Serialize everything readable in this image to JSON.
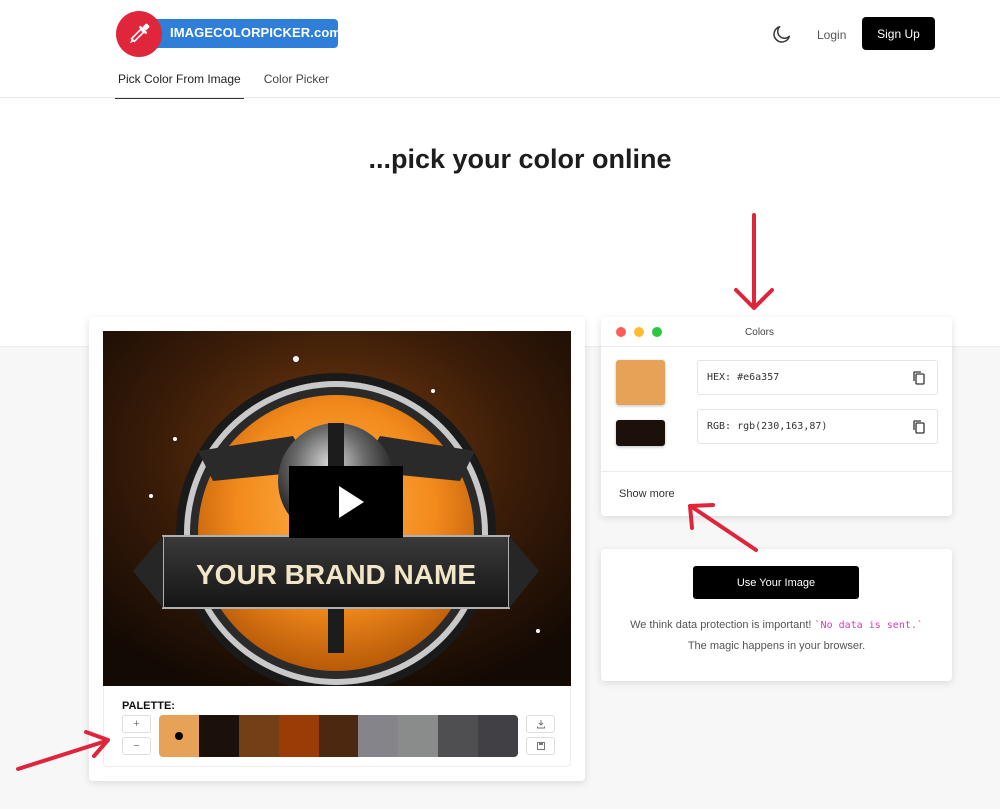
{
  "header": {
    "logo_text": "IMAGECOLORPICKER.com",
    "tabs": [
      {
        "label": "Pick Color From Image",
        "active": true
      },
      {
        "label": "Color Picker",
        "active": false
      }
    ],
    "theme_icon": "moon-icon",
    "login_label": "Login",
    "signup_label": "Sign Up"
  },
  "hero": {
    "title": "...pick your color online"
  },
  "image_card": {
    "image_text": "YOUR BRAND NAME",
    "palette_label": "PALETTE:",
    "add_label": "+",
    "remove_label": "−",
    "download_icon": "download-icon",
    "save_icon": "save-icon",
    "palette": [
      "#e6a357",
      "#1c100a",
      "#743f16",
      "#9b3c06",
      "#4c2810",
      "#85848a",
      "#8a8b8b",
      "#4f4e51",
      "#414045"
    ],
    "selected_index": 0
  },
  "colors_card": {
    "title": "Colors",
    "window_dots": [
      "#ff5f57",
      "#febc2e",
      "#28c840"
    ],
    "primary_color": "#e6a357",
    "secondary_color": "#1c100a",
    "hex_label": "HEX: #e6a357",
    "rgb_label": "RGB: rgb(230,163,87)",
    "show_more_label": "Show more"
  },
  "upload_card": {
    "button_label": "Use Your Image",
    "privacy_before": "We think data protection is important!",
    "privacy_code": "`No data is sent.`",
    "privacy_after": "The magic happens in your browser."
  },
  "annotations": {
    "arrow_color": "#e0243a"
  }
}
